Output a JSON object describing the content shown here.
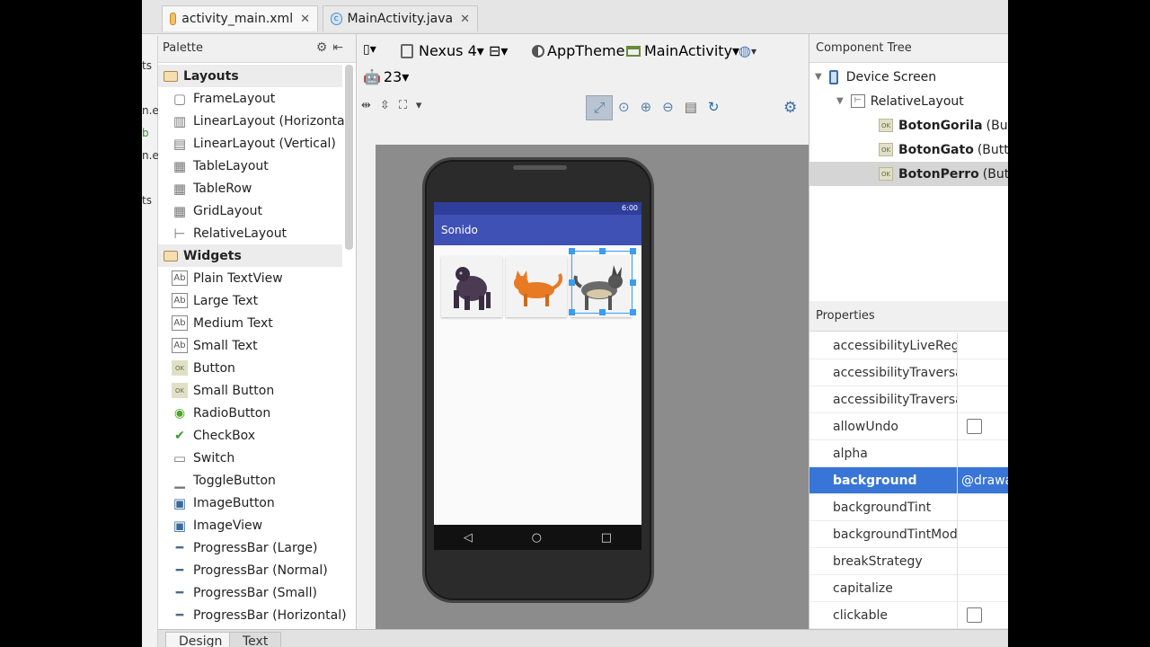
{
  "tabs": [
    {
      "label": "activity_main.xml",
      "icon": "xml-layout-icon",
      "active": true
    },
    {
      "label": "MainActivity.java",
      "icon": "java-class-icon",
      "active": false
    }
  ],
  "left_sliver": [
    "ts",
    "n.e",
    "b",
    "n.e",
    "ts"
  ],
  "palette": {
    "title": "Palette",
    "groups": [
      {
        "label": "Layouts",
        "items": [
          "FrameLayout",
          "LinearLayout (Horizontal)",
          "LinearLayout (Vertical)",
          "TableLayout",
          "TableRow",
          "GridLayout",
          "RelativeLayout"
        ]
      },
      {
        "label": "Widgets",
        "items": [
          "Plain TextView",
          "Large Text",
          "Medium Text",
          "Small Text",
          "Button",
          "Small Button",
          "RadioButton",
          "CheckBox",
          "Switch",
          "ToggleButton",
          "ImageButton",
          "ImageView",
          "ProgressBar (Large)",
          "ProgressBar (Normal)",
          "ProgressBar (Small)",
          "ProgressBar (Horizontal)"
        ]
      }
    ]
  },
  "toolbar": {
    "device": "Nexus 4",
    "theme": "AppTheme",
    "activity": "MainActivity",
    "api": "23"
  },
  "preview": {
    "status_time": "6:00",
    "app_title": "Sonido"
  },
  "component_tree": {
    "title": "Component Tree",
    "device": "Device Screen",
    "layout": "RelativeLayout",
    "buttons": [
      {
        "name": "BotonGorila",
        "type": "(Butt"
      },
      {
        "name": "BotonGato",
        "type": "(Butto"
      },
      {
        "name": "BotonPerro",
        "type": "(Butt"
      }
    ]
  },
  "properties": {
    "title": "Properties",
    "rows": [
      {
        "name": "accessibilityLiveRegio",
        "value": "",
        "checkbox": false
      },
      {
        "name": "accessibilityTraversalA",
        "value": "",
        "checkbox": false
      },
      {
        "name": "accessibilityTraversalB",
        "value": "",
        "checkbox": false
      },
      {
        "name": "allowUndo",
        "value": "",
        "checkbox": true
      },
      {
        "name": "alpha",
        "value": "",
        "checkbox": false
      },
      {
        "name": "background",
        "value": "@drawa",
        "checkbox": false,
        "selected": true
      },
      {
        "name": "backgroundTint",
        "value": "",
        "checkbox": false
      },
      {
        "name": "backgroundTintMode",
        "value": "",
        "checkbox": false
      },
      {
        "name": "breakStrategy",
        "value": "",
        "checkbox": false
      },
      {
        "name": "capitalize",
        "value": "",
        "checkbox": false
      },
      {
        "name": "clickable",
        "value": "",
        "checkbox": true
      }
    ]
  },
  "bottom_tabs": [
    "Design",
    "Text"
  ],
  "colors": {
    "accent": "#3875d7",
    "appbar": "#3f51b5",
    "status": "#2e3e9a"
  }
}
